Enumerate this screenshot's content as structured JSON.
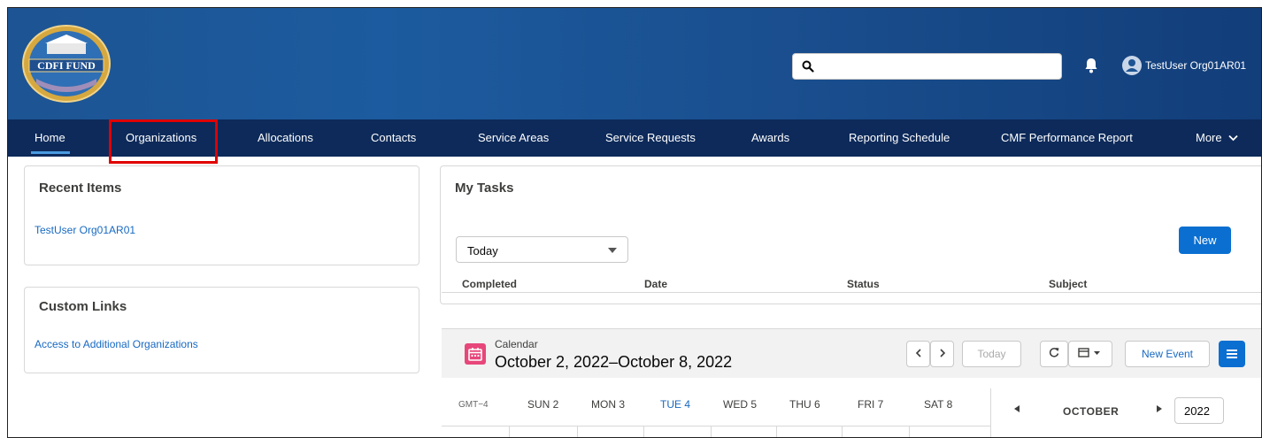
{
  "header": {
    "logo_text": "CDFI FUND",
    "username": "TestUser Org01AR01",
    "search_placeholder": ""
  },
  "nav": {
    "items": [
      "Home",
      "Organizations",
      "Allocations",
      "Contacts",
      "Service Areas",
      "Service Requests",
      "Awards",
      "Reporting Schedule",
      "CMF Performance Report",
      "More"
    ],
    "active": "Home",
    "highlighted": "Organizations"
  },
  "recent_items": {
    "title": "Recent Items",
    "links": [
      "TestUser Org01AR01"
    ]
  },
  "custom_links": {
    "title": "Custom Links",
    "links": [
      "Access to Additional Organizations"
    ]
  },
  "tasks": {
    "title": "My Tasks",
    "filter": "Today",
    "new_label": "New",
    "columns": [
      "Completed",
      "Date",
      "Status",
      "Subject"
    ]
  },
  "calendar": {
    "label": "Calendar",
    "range": "October 2, 2022–October 8, 2022",
    "today_label": "Today",
    "new_event_label": "New Event",
    "timezone": "GMT−4",
    "days": [
      "SUN 2",
      "MON 3",
      "TUE 4",
      "WED 5",
      "THU 6",
      "FRI 7",
      "SAT 8"
    ],
    "today_day": "TUE 4",
    "mini_month": "OCTOBER",
    "mini_year": "2022"
  },
  "colors": {
    "brand_blue": "#0a6fd1",
    "nav_bg": "#0d2a5a",
    "highlight_red": "#e00000",
    "calendar_icon": "#e7477b"
  }
}
